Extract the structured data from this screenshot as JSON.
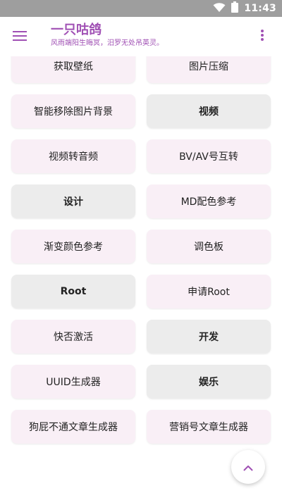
{
  "status_bar": {
    "time": "11:43",
    "icons": [
      "wifi-icon",
      "battery-icon"
    ]
  },
  "app_bar": {
    "title": "一只咕鸽",
    "subtitle": "风雨端阳生晦冥，汨罗无处吊英灵。",
    "menu_icon": "menu-icon",
    "more_icon": "more-vert-icon"
  },
  "grid": {
    "items": [
      {
        "label": "获取壁纸",
        "kind": "item"
      },
      {
        "label": "图片压缩",
        "kind": "item"
      },
      {
        "label": "智能移除图片背景",
        "kind": "item"
      },
      {
        "label": "视频",
        "kind": "category"
      },
      {
        "label": "视频转音频",
        "kind": "item"
      },
      {
        "label": "BV/AV号互转",
        "kind": "item"
      },
      {
        "label": "设计",
        "kind": "category"
      },
      {
        "label": "MD配色参考",
        "kind": "item"
      },
      {
        "label": "渐变颜色参考",
        "kind": "item"
      },
      {
        "label": "调色板",
        "kind": "item"
      },
      {
        "label": "Root",
        "kind": "category"
      },
      {
        "label": "申请Root",
        "kind": "item"
      },
      {
        "label": "快否激活",
        "kind": "item"
      },
      {
        "label": "开发",
        "kind": "category"
      },
      {
        "label": "UUID生成器",
        "kind": "item"
      },
      {
        "label": "娱乐",
        "kind": "category"
      },
      {
        "label": "狗屁不通文章生成器",
        "kind": "item"
      },
      {
        "label": "营销号文章生成器",
        "kind": "item"
      }
    ]
  },
  "fab": {
    "icon": "chevron-up-icon"
  },
  "colors": {
    "accent": "#a050b4",
    "item_background": "#f9eff6",
    "category_background": "#ececec",
    "status_bar": "#9e9e9e"
  }
}
